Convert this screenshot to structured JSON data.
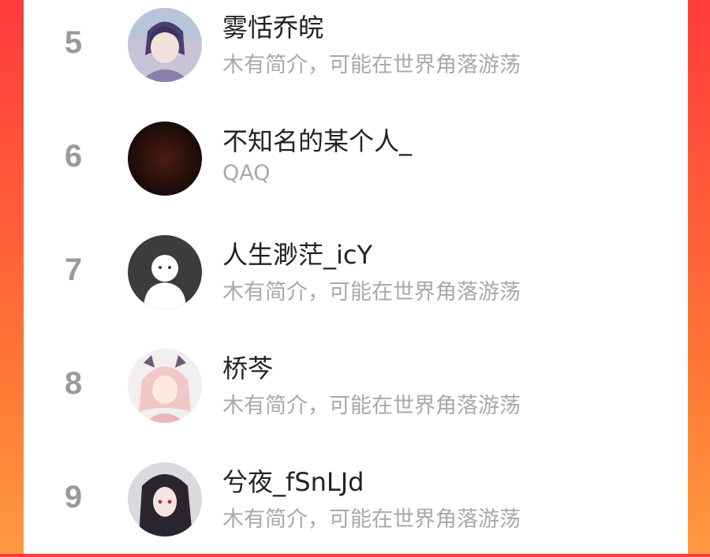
{
  "colors": {
    "background_gradient": [
      "#ff3b3b",
      "#ff9a40"
    ],
    "panel": "#ffffff",
    "rank": "#9a9a9a",
    "name": "#222222",
    "bio": "#a9a9a9"
  },
  "users": [
    {
      "rank": "5",
      "name": "雾恬乔皖",
      "bio": "木有简介，可能在世界角落游荡",
      "avatar": "anime-girl-purple-avatar"
    },
    {
      "rank": "6",
      "name": "不知名的某个人_",
      "bio": "QAQ",
      "avatar": "dark-brown-avatar"
    },
    {
      "rank": "7",
      "name": "人生渺茫_icY",
      "bio": "木有简介，可能在世界角落游荡",
      "avatar": "default-ghost-avatar"
    },
    {
      "rank": "8",
      "name": "桥芩",
      "bio": "木有简介，可能在世界角落游荡",
      "avatar": "anime-pink-hair-avatar"
    },
    {
      "rank": "9",
      "name": "兮夜_fSnLJd",
      "bio": "木有简介，可能在世界角落游荡",
      "avatar": "anime-dark-hair-avatar"
    }
  ]
}
